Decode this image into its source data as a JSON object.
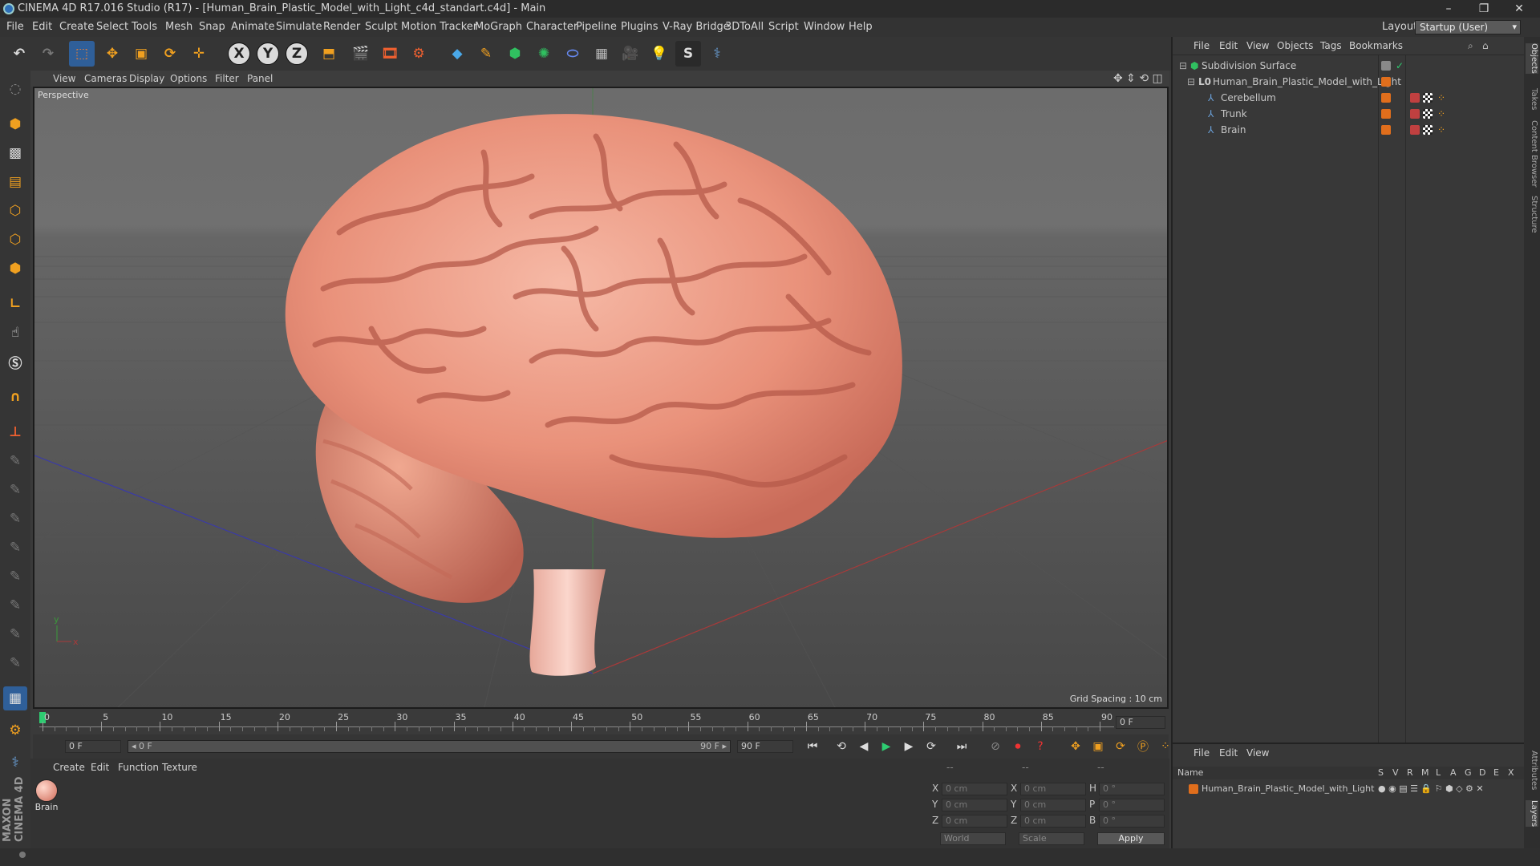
{
  "window": {
    "title": "CINEMA 4D R17.016 Studio (R17) - [Human_Brain_Plastic_Model_with_Light_c4d_standart.c4d] - Main",
    "minimize": "–",
    "restore": "❐",
    "close": "✕"
  },
  "menubar": {
    "items": [
      "File",
      "Edit",
      "Create",
      "Select",
      "Tools",
      "Mesh",
      "Snap",
      "Animate",
      "Simulate",
      "Render",
      "Sculpt",
      "Motion Tracker",
      "MoGraph",
      "Character",
      "Pipeline",
      "Plugins",
      "V-Ray Bridge",
      "3DToAll",
      "Script",
      "Window",
      "Help"
    ],
    "layout_label": "Layout:",
    "layout_value": "Startup (User)"
  },
  "toolbar": {
    "undo_icon": "undo-icon",
    "axis_x": "X",
    "axis_y": "Y",
    "axis_z": "Z"
  },
  "viewport": {
    "menu": [
      "View",
      "Cameras",
      "Display",
      "Options",
      "Filter",
      "Panel"
    ],
    "camera_label": "Perspective",
    "grid_spacing": "Grid Spacing : 10 cm",
    "axis_y": "y",
    "axis_x": "x"
  },
  "timeline": {
    "ticks": [
      "0",
      "5",
      "10",
      "15",
      "20",
      "25",
      "30",
      "35",
      "40",
      "45",
      "50",
      "55",
      "60",
      "65",
      "70",
      "75",
      "80",
      "85",
      "90"
    ],
    "current_frame": "0 F"
  },
  "transport": {
    "start_field": "0 F",
    "range_left": "◂ 0 F",
    "range_right": "90 F ▸",
    "end_field": "90 F"
  },
  "materials": {
    "menu": [
      "Create",
      "Edit",
      "Function",
      "Texture"
    ],
    "items": [
      {
        "name": "Brain"
      }
    ]
  },
  "coordinates": {
    "header": [
      "--",
      "--",
      "--"
    ],
    "rows": [
      {
        "a": "X",
        "av": "0 cm",
        "b": "X",
        "bv": "0 cm",
        "c": "H",
        "cv": "0 °"
      },
      {
        "a": "Y",
        "av": "0 cm",
        "b": "Y",
        "bv": "0 cm",
        "c": "P",
        "cv": "0 °"
      },
      {
        "a": "Z",
        "av": "0 cm",
        "b": "Z",
        "bv": "0 cm",
        "c": "B",
        "cv": "0 °"
      }
    ],
    "space": "World",
    "mode": "Scale",
    "apply": "Apply"
  },
  "objects": {
    "menu": [
      "File",
      "Edit",
      "View",
      "Objects",
      "Tags",
      "Bookmarks"
    ],
    "items": [
      {
        "name": "Subdivision Surface",
        "level": 0
      },
      {
        "name": "Human_Brain_Plastic_Model_with_Light",
        "level": 1
      },
      {
        "name": "Cerebellum",
        "level": 2
      },
      {
        "name": "Trunk",
        "level": 2
      },
      {
        "name": "Brain",
        "level": 2
      }
    ]
  },
  "layers": {
    "menu": [
      "File",
      "Edit",
      "View"
    ],
    "columns": [
      "Name",
      "S",
      "V",
      "R",
      "M",
      "L",
      "A",
      "G",
      "D",
      "E",
      "X"
    ],
    "items": [
      {
        "name": "Human_Brain_Plastic_Model_with_Light"
      }
    ]
  },
  "side_tabs": [
    "Objects",
    "Takes",
    "Content Browser",
    "Structure"
  ],
  "side_tabs_bottom": [
    "Attributes",
    "Layers"
  ],
  "branding": {
    "maxon": "MAXON",
    "product": "CINEMA 4D"
  },
  "colors": {
    "accent": "#d06a2a",
    "orange_tag": "#e06e1c",
    "selection_blue": "#2f5f99"
  }
}
